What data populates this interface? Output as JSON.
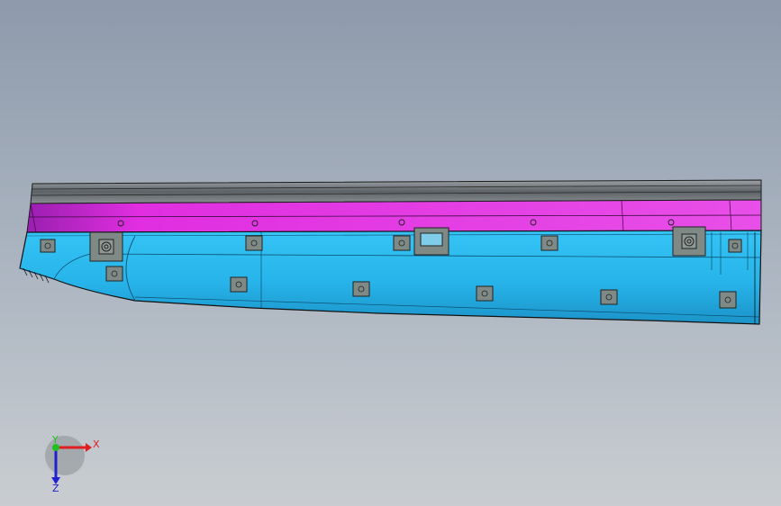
{
  "viewport": {
    "background_top": "#8e9aab",
    "background_bottom": "#c9cdd1"
  },
  "model": {
    "body_color": "#27b4ea",
    "body_shadow_color": "#1a8fc4",
    "stripe_color": "#e02ee0",
    "stripe_dark_color": "#9a1fb0",
    "rail_color": "#6f7478",
    "clip_color": "#7f8a86"
  },
  "triad": {
    "x_label": "X",
    "y_label": "Y",
    "z_label": "Z",
    "x_color": "#e02020",
    "y_color": "#20c020",
    "z_color": "#2020d0"
  }
}
